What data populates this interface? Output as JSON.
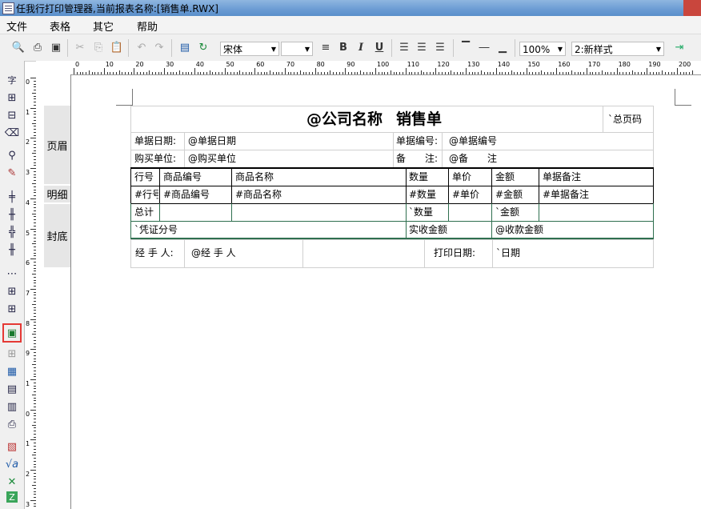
{
  "window": {
    "title": "任我行打印管理器,当前报表名称:[销售单.RWX]"
  },
  "menu": [
    "文件",
    "表格",
    "其它",
    "帮助"
  ],
  "toolbar": {
    "font_name": "宋体",
    "font_size": "",
    "bold": "B",
    "italic": "I",
    "underline": "U",
    "zoom": "100%",
    "style": "2:新样式"
  },
  "ruler": {
    "h_labels": [
      "0",
      "10",
      "20",
      "30",
      "40",
      "50",
      "60",
      "70",
      "80",
      "90",
      "100",
      "110",
      "120",
      "130",
      "140",
      "150",
      "160",
      "170",
      "180",
      "190",
      "200"
    ],
    "v_labels": [
      "0",
      "1",
      "2",
      "3",
      "4",
      "5",
      "6",
      "7",
      "8",
      "9",
      "1",
      "0",
      "1",
      "2",
      "3"
    ]
  },
  "bands": {
    "header": "页眉",
    "detail": "明细",
    "footer": "封底"
  },
  "report": {
    "company": "@公司名称",
    "title": "销售单",
    "page_num": "`总页码",
    "info": {
      "date_label": "单据日期:",
      "date_value": "@单据日期",
      "no_label": "单据编号:",
      "no_value": "@单据编号",
      "buyer_label": "购买单位:",
      "buyer_value": "@购买单位",
      "note_label": "备　　注:",
      "note_value": "@备　　注"
    },
    "table_headers": [
      "行号",
      "商品编号",
      "商品名称",
      "数量",
      "单价",
      "金额",
      "单据备注"
    ],
    "table_row": [
      "#行号",
      "#商品编号",
      "#商品名称",
      "#数量",
      "#单价",
      "#金额",
      "#单据备注"
    ],
    "total_row": {
      "label": "总计",
      "qty": "`数量",
      "amount": "`金额"
    },
    "voucher_row": {
      "voucher": "`凭证分号",
      "paid_label": "实收金额",
      "paid_value": "@收款金额"
    },
    "footer": {
      "handler_label": "经 手 人:",
      "handler_value": "@经 手 人",
      "print_date_label": "打印日期:",
      "print_date_value": "`日期"
    }
  }
}
